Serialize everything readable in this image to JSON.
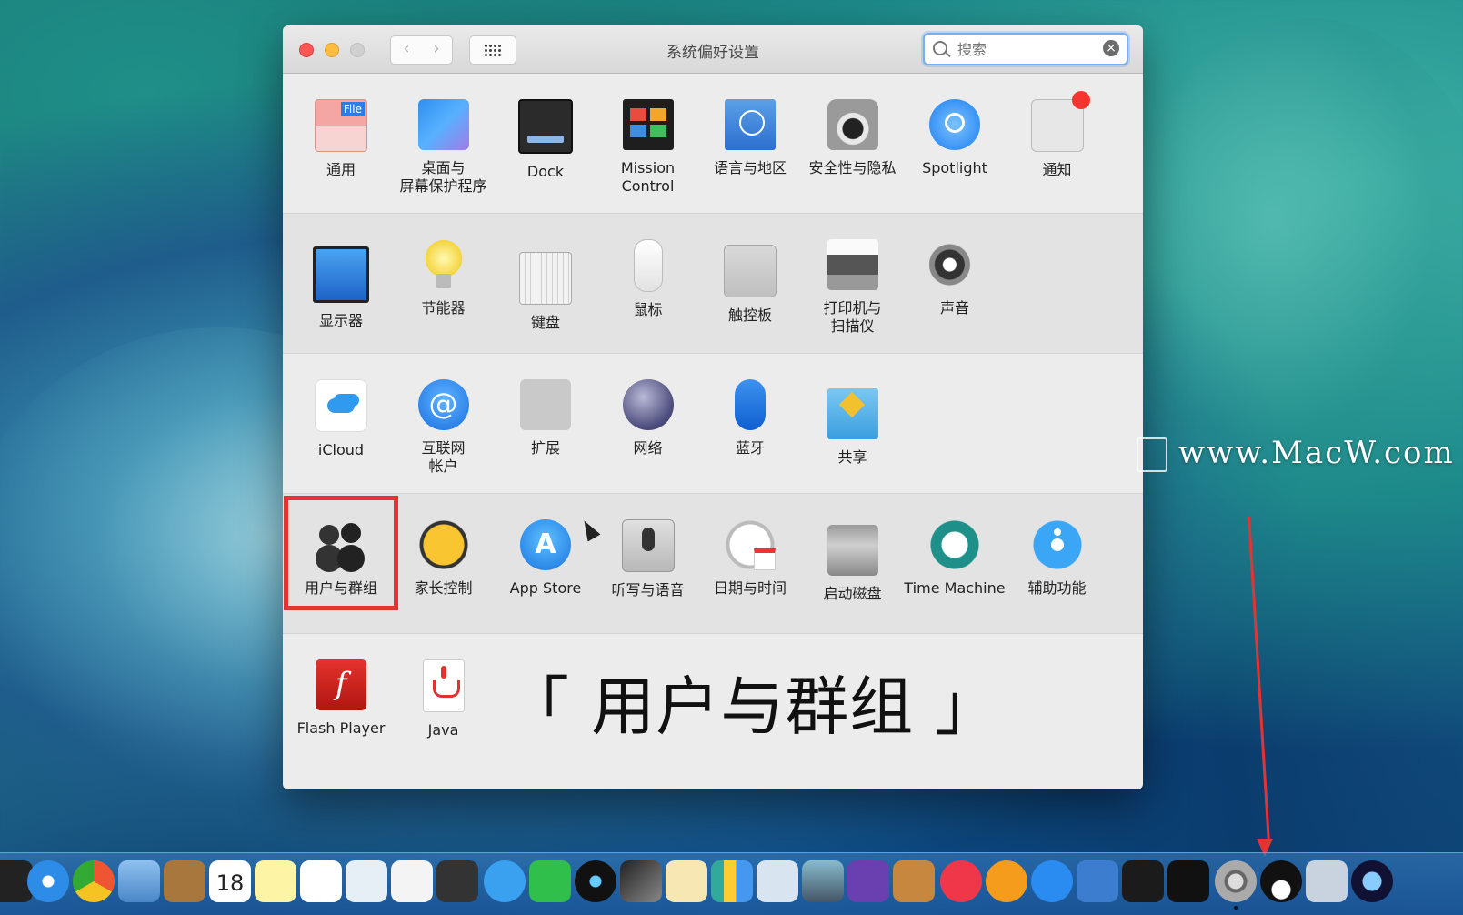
{
  "window": {
    "title": "系统偏好设置",
    "search_placeholder": "搜索"
  },
  "rows": [
    [
      {
        "label": "通用",
        "icon": "general-icon"
      },
      {
        "label": "桌面与\n屏幕保护程序",
        "icon": "desktop-screensaver-icon"
      },
      {
        "label": "Dock",
        "icon": "dock-icon"
      },
      {
        "label": "Mission\nControl",
        "icon": "mission-control-icon"
      },
      {
        "label": "语言与地区",
        "icon": "language-region-icon"
      },
      {
        "label": "安全性与隐私",
        "icon": "security-privacy-icon"
      },
      {
        "label": "Spotlight",
        "icon": "spotlight-icon"
      },
      {
        "label": "通知",
        "icon": "notifications-icon"
      }
    ],
    [
      {
        "label": "显示器",
        "icon": "displays-icon"
      },
      {
        "label": "节能器",
        "icon": "energy-saver-icon"
      },
      {
        "label": "键盘",
        "icon": "keyboard-icon"
      },
      {
        "label": "鼠标",
        "icon": "mouse-icon"
      },
      {
        "label": "触控板",
        "icon": "trackpad-icon"
      },
      {
        "label": "打印机与\n扫描仪",
        "icon": "printers-scanners-icon"
      },
      {
        "label": "声音",
        "icon": "sound-icon"
      }
    ],
    [
      {
        "label": "iCloud",
        "icon": "icloud-icon"
      },
      {
        "label": "互联网\n帐户",
        "icon": "internet-accounts-icon"
      },
      {
        "label": "扩展",
        "icon": "extensions-icon"
      },
      {
        "label": "网络",
        "icon": "network-icon"
      },
      {
        "label": "蓝牙",
        "icon": "bluetooth-icon"
      },
      {
        "label": "共享",
        "icon": "sharing-icon"
      }
    ],
    [
      {
        "label": "用户与群组",
        "icon": "users-groups-icon"
      },
      {
        "label": "家长控制",
        "icon": "parental-controls-icon"
      },
      {
        "label": "App Store",
        "icon": "app-store-icon"
      },
      {
        "label": "听写与语音",
        "icon": "dictation-speech-icon"
      },
      {
        "label": "日期与时间",
        "icon": "date-time-icon"
      },
      {
        "label": "启动磁盘",
        "icon": "startup-disk-icon"
      },
      {
        "label": "Time Machine",
        "icon": "time-machine-icon"
      },
      {
        "label": "辅助功能",
        "icon": "accessibility-icon"
      }
    ],
    [
      {
        "label": "Flash Player",
        "icon": "flash-player-icon"
      },
      {
        "label": "Java",
        "icon": "java-icon"
      }
    ]
  ],
  "caption": "「 用户与群组 」",
  "watermark": "www.MacW.com",
  "dock": {
    "calendar_day": "18"
  },
  "colors": {
    "highlight": "#e53333",
    "search_focus": "#7aacf0"
  }
}
